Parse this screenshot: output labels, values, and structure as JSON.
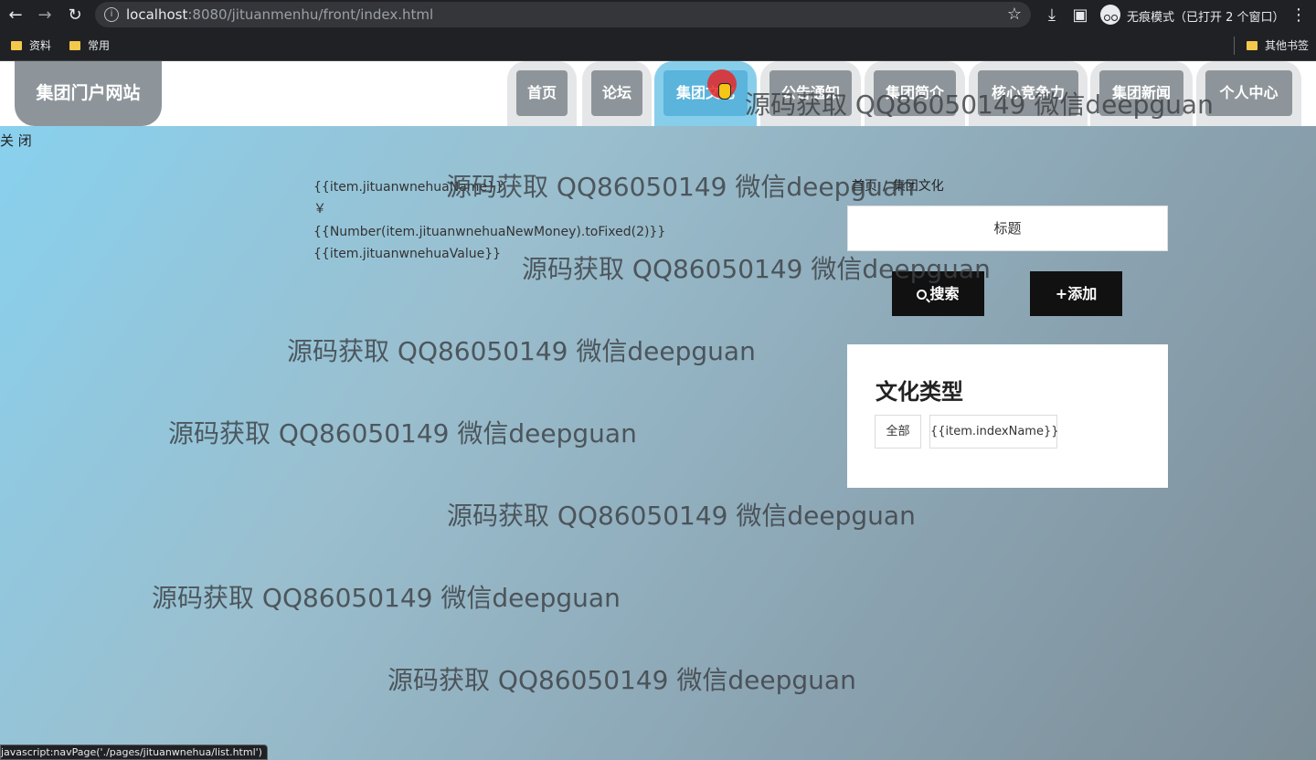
{
  "browser": {
    "url_host": "localhost",
    "url_path": ":8080/jituanmenhu/front/index.html",
    "incognito_label": "无痕模式（已打开 2 个窗口）",
    "bookmarks": [
      "资料",
      "常用"
    ],
    "other_bookmarks": "其他书签",
    "status_url": "javascript:navPage('./pages/jituanwnehua/list.html')"
  },
  "header": {
    "logo": "集团门户网站",
    "nav": [
      "首页",
      "论坛",
      "集团文化",
      "公告通知",
      "集团简介",
      "核心竞争力",
      "集团新闻",
      "个人中心"
    ],
    "active_nav": "集团文化"
  },
  "page": {
    "close_label": "关 闭",
    "template_lines": [
      "{{item.jituanwnehuaName}}",
      "￥",
      "{{Number(item.jituanwnehuaNewMoney).toFixed(2)}}",
      "{{item.jituanwnehuaValue}}"
    ],
    "breadcrumb": {
      "home": "首页",
      "separator": "/",
      "current": "集团文化"
    },
    "search_placeholder": "标题",
    "search_button": "搜索",
    "add_button": "+添加",
    "type_panel": {
      "title": "文化类型",
      "chips": [
        "全部",
        "{{item.indexName}}"
      ]
    }
  },
  "watermark": "源码获取 QQ86050149 微信deepguan",
  "colors": {
    "nav_bg": "#e4e6e8",
    "nav_inner": "#8e959a",
    "active_tab": "#87ceeb",
    "button": "#111111"
  }
}
